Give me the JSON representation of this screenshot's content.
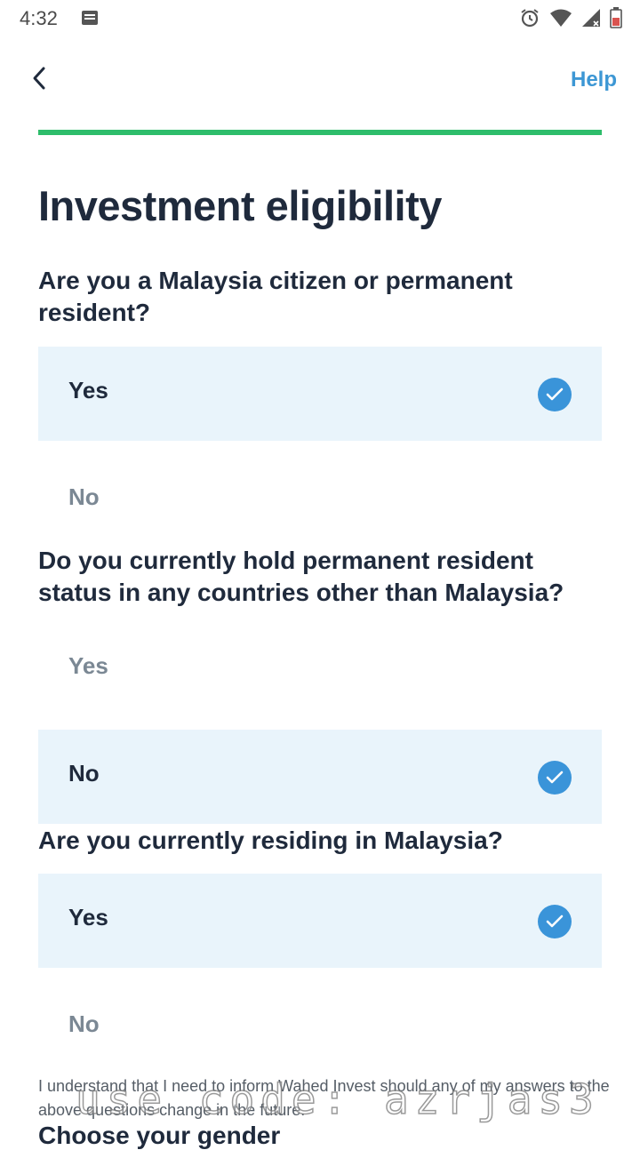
{
  "status_bar": {
    "time": "4:32"
  },
  "header": {
    "help_label": "Help"
  },
  "progress": {
    "fraction": 1.0,
    "color": "#2ebd6b"
  },
  "title": "Investment eligibility",
  "questions": [
    {
      "text": "Are you a Malaysia citizen or permanent resident?",
      "options": [
        {
          "label": "Yes",
          "selected": true
        },
        {
          "label": "No",
          "selected": false
        }
      ]
    },
    {
      "text": "Do you currently hold permanent resident status in any countries other than Malaysia?",
      "options": [
        {
          "label": "Yes",
          "selected": false
        },
        {
          "label": "No",
          "selected": true
        }
      ]
    },
    {
      "text": "Are you currently residing in Malaysia?",
      "options": [
        {
          "label": "Yes",
          "selected": true
        },
        {
          "label": "No",
          "selected": false
        }
      ]
    }
  ],
  "disclaimer": "I understand that I need to inform Wahed Invest should any of my answers to the above questions change in the future.",
  "next_section_title": "Choose your gender",
  "watermark": "use code: azrjas3",
  "colors": {
    "accent": "#3d97d4",
    "selected_bg": "#e9f4fb",
    "check": "#3a94d9",
    "text": "#1f2a3c"
  }
}
